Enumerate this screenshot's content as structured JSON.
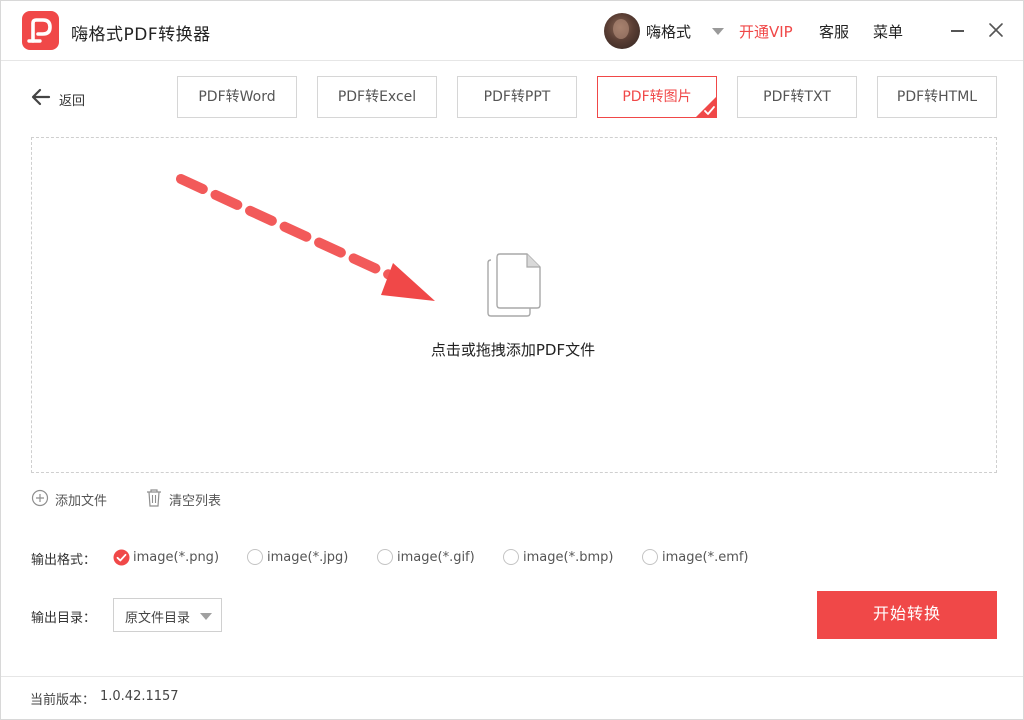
{
  "app": {
    "title": "嗨格式PDF转换器"
  },
  "header": {
    "username": "嗨格式",
    "vip": "开通VIP",
    "service": "客服",
    "menu": "菜单"
  },
  "nav": {
    "back": "返回",
    "tabs": [
      {
        "label": "PDF转Word",
        "active": false
      },
      {
        "label": "PDF转Excel",
        "active": false
      },
      {
        "label": "PDF转PPT",
        "active": false
      },
      {
        "label": "PDF转图片",
        "active": true
      },
      {
        "label": "PDF转TXT",
        "active": false
      },
      {
        "label": "PDF转HTML",
        "active": false
      }
    ]
  },
  "dropzone": {
    "hint": "点击或拖拽添加PDF文件"
  },
  "file_actions": {
    "add": "添加文件",
    "clear": "清空列表"
  },
  "output": {
    "format_label": "输出格式：",
    "formats": [
      {
        "label": "image(*.png)",
        "selected": true
      },
      {
        "label": "image(*.jpg)",
        "selected": false
      },
      {
        "label": "image(*.gif)",
        "selected": false
      },
      {
        "label": "image(*.bmp)",
        "selected": false
      },
      {
        "label": "image(*.emf)",
        "selected": false
      }
    ],
    "dir_label": "输出目录：",
    "dir_value": "原文件目录",
    "start": "开始转换"
  },
  "footer": {
    "version_label": "当前版本：",
    "version": "1.0.42.1157"
  },
  "colors": {
    "accent": "#f04848",
    "border": "#d6d6d6",
    "text": "#333333"
  },
  "icons": {
    "logo": "pdf-logo-icon",
    "back": "arrow-left-icon",
    "file": "file-stack-icon",
    "add": "plus-circle-icon",
    "clear": "trash-icon",
    "check": "check-icon"
  }
}
